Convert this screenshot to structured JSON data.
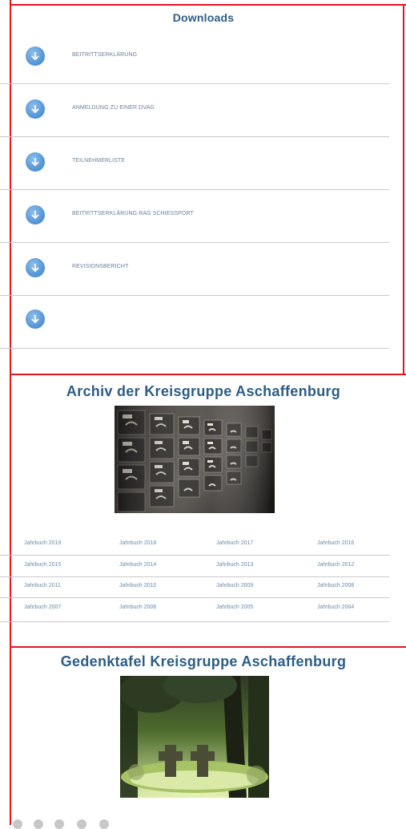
{
  "downloads": {
    "title": "Downloads",
    "items": [
      {
        "label": "BEITRITTSERKLÄRUNG"
      },
      {
        "label": "ANMELDUNG ZU EINER DVAG"
      },
      {
        "label": "TEILNEHMERLISTE"
      },
      {
        "label": "BEITRITTSERKLÄRUNG RAG SCHIESSPORT"
      },
      {
        "label": "REVISIONSBERICHT"
      },
      {
        "label": ""
      }
    ]
  },
  "archive": {
    "title": "Archiv der Kreisgruppe Aschaffenburg",
    "yearbooks": [
      [
        "Jahrbuch 2019",
        "Jahrbuch 2018",
        "Jahrbuch 2017",
        "Jahrbuch 2016"
      ],
      [
        "Jahrbuch 2015",
        "Jahrbuch 2014",
        "Jahrbuch 2013",
        "Jahrbuch 2012"
      ],
      [
        "Jahrbuch 2011",
        "Jahrbuch 2010",
        "Jahrbuch 2009",
        "Jahrbuch 2008"
      ],
      [
        "Jahrbuch 2007",
        "Jahrbuch 2006",
        "Jahrbuch 2005",
        "Jahrbuch 2004"
      ]
    ]
  },
  "memorial": {
    "title": "Gedenktafel Kreisgruppe Aschaffenburg"
  },
  "colors": {
    "frame": "#e8141b",
    "heading": "#2e5d83",
    "icon": "#5a9ad8"
  }
}
